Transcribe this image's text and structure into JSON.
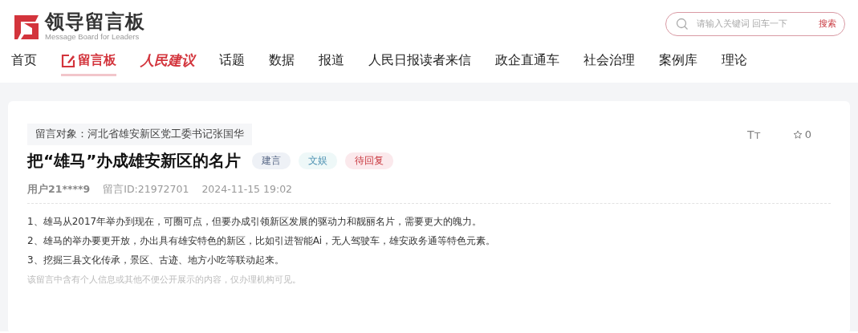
{
  "logo": {
    "title": "领导留言板",
    "subtitle": "Message Board for Leaders"
  },
  "search": {
    "placeholder": "请输入关键词 回车一下",
    "button": "搜索"
  },
  "nav": [
    {
      "label": "首页",
      "kind": "text",
      "selected": false
    },
    {
      "label": "留言板",
      "kind": "board",
      "selected": true
    },
    {
      "label": "人民建议",
      "kind": "script",
      "selected": false
    },
    {
      "label": "话题",
      "kind": "text",
      "selected": false
    },
    {
      "label": "数据",
      "kind": "text",
      "selected": false
    },
    {
      "label": "报道",
      "kind": "text",
      "selected": false
    },
    {
      "label": "人民日报读者来信",
      "kind": "text",
      "selected": false
    },
    {
      "label": "政企直通车",
      "kind": "text",
      "selected": false
    },
    {
      "label": "社会治理",
      "kind": "text",
      "selected": false
    },
    {
      "label": "案例库",
      "kind": "text",
      "selected": false
    },
    {
      "label": "理论",
      "kind": "text",
      "selected": false
    }
  ],
  "message": {
    "target": "留言对象：河北省雄安新区党工委书记张国华",
    "title": "把“雄马”办成雄安新区的名片",
    "tags": [
      {
        "label": "建言",
        "color": "#eef1f6"
      },
      {
        "label": "文娱",
        "color": "#eef8f8"
      },
      {
        "label": "待回复",
        "color": "#fbe9ec"
      }
    ],
    "font_size_control": "Tт",
    "favorites": "0",
    "user": "用户21****9",
    "id": "留言ID:21972701",
    "time": "2024-11-15 19:02",
    "paragraphs": [
      "1、雄马从2017年举办到现在，可圈可点，但要办成引领新区发展的驱动力和靓丽名片，需要更大的魄力。",
      "2、雄马的举办要更开放，办出具有雄安特色的新区，比如引进智能Ai，无人驾驶车，雄安政务通等特色元素。",
      "3、挖掘三县文化传承，景区、古迹、地方小吃等联动起来。"
    ],
    "notice": "该留言中含有个人信息或其他不便公开展示的内容，仅办理机构可见。"
  }
}
